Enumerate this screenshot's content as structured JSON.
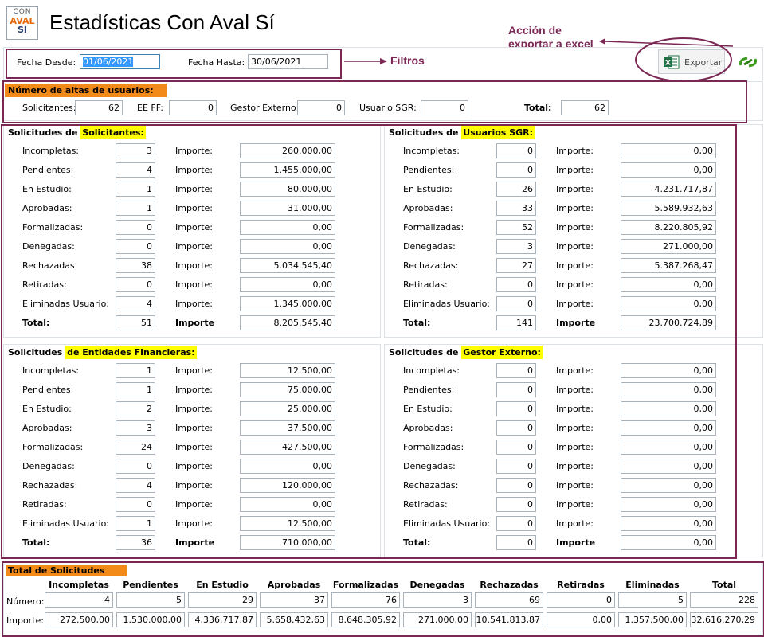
{
  "logo": {
    "line1": "CON",
    "line2": "AVAL",
    "line3": "SÍ"
  },
  "title": "Estadísticas Con Aval Sí",
  "filters": {
    "desde_label": "Fecha Desde:",
    "desde_value": "01/06/2021",
    "hasta_label": "Fecha Hasta:",
    "hasta_value": "30/06/2021"
  },
  "annotations": {
    "filtros": "Filtros",
    "export_line1": "Acción de",
    "export_line2": "exportar a excel"
  },
  "export": {
    "label": "Exportar"
  },
  "altas": {
    "title": "Número de altas de usuarios:",
    "solicitantes_label": "Solicitantes:",
    "solicitantes": "62",
    "eeff_label": "EE FF:",
    "eeff": "0",
    "gestor_label": "Gestor Externo:",
    "gestor": "0",
    "sgr_label": "Usuario SGR:",
    "sgr": "0",
    "total_label": "Total:",
    "total": "62"
  },
  "row_labels": [
    "Incompletas:",
    "Pendientes:",
    "En Estudio:",
    "Aprobadas:",
    "Formalizadas:",
    "Denegadas:",
    "Rechazadas:",
    "Retiradas:",
    "Eliminadas Usuario:"
  ],
  "importe_label": "Importe:",
  "total_label": "Total:",
  "importe_total_label": "Importe",
  "sections": [
    {
      "prefix": "Solicitudes de ",
      "highlight": "Solicitantes:",
      "counts": [
        "3",
        "4",
        "1",
        "1",
        "0",
        "0",
        "38",
        "0",
        "4"
      ],
      "importes": [
        "260.000,00",
        "1.455.000,00",
        "80.000,00",
        "31.000,00",
        "0,00",
        "0,00",
        "5.034.545,40",
        "0,00",
        "1.345.000,00"
      ],
      "total": "51",
      "total_importe": "8.205.545,40"
    },
    {
      "prefix": "Solicitudes de ",
      "highlight": "Usuarios SGR:",
      "counts": [
        "0",
        "0",
        "26",
        "33",
        "52",
        "3",
        "27",
        "0",
        "0"
      ],
      "importes": [
        "0,00",
        "0,00",
        "4.231.717,87",
        "5.589.932,63",
        "8.220.805,92",
        "271.000,00",
        "5.387.268,47",
        "0,00",
        "0,00"
      ],
      "total": "141",
      "total_importe": "23.700.724,89"
    },
    {
      "prefix": "Solicitudes ",
      "highlight": "de Entidades Financieras:",
      "counts": [
        "1",
        "1",
        "2",
        "3",
        "24",
        "0",
        "4",
        "0",
        "1"
      ],
      "importes": [
        "12.500,00",
        "75.000,00",
        "25.000,00",
        "37.500,00",
        "427.500,00",
        "0,00",
        "120.000,00",
        "0,00",
        "12.500,00"
      ],
      "total": "36",
      "total_importe": "710.000,00"
    },
    {
      "prefix": "Solicitudes de ",
      "highlight": "Gestor Externo:",
      "counts": [
        "0",
        "0",
        "0",
        "0",
        "0",
        "0",
        "0",
        "0",
        "0"
      ],
      "importes": [
        "0,00",
        "0,00",
        "0,00",
        "0,00",
        "0,00",
        "0,00",
        "0,00",
        "0,00",
        "0,00"
      ],
      "total": "0",
      "total_importe": "0,00"
    }
  ],
  "totals": {
    "title": "Total de Solicitudes",
    "headers": [
      "Incompletas",
      "Pendientes",
      "En Estudio",
      "Aprobadas",
      "Formalizadas",
      "Denegadas",
      "Rechazadas",
      "Retiradas",
      "Eliminadas Us",
      "Total"
    ],
    "numero_label": "Número:",
    "importe_label": "Importe:",
    "numero": [
      "4",
      "5",
      "29",
      "37",
      "76",
      "3",
      "69",
      "0",
      "5",
      "228"
    ],
    "importe": [
      "272.500,00",
      "1.530.000,00",
      "4.336.717,87",
      "5.658.432,63",
      "8.648.305,92",
      "271.000,00",
      "10.541.813,87",
      "0,00",
      "1.357.500,00",
      "32.616.270,29"
    ]
  },
  "colors": {
    "annotation": "#7a2754",
    "highlight_yellow": "#ffff00",
    "highlight_orange": "#f28a1a"
  }
}
